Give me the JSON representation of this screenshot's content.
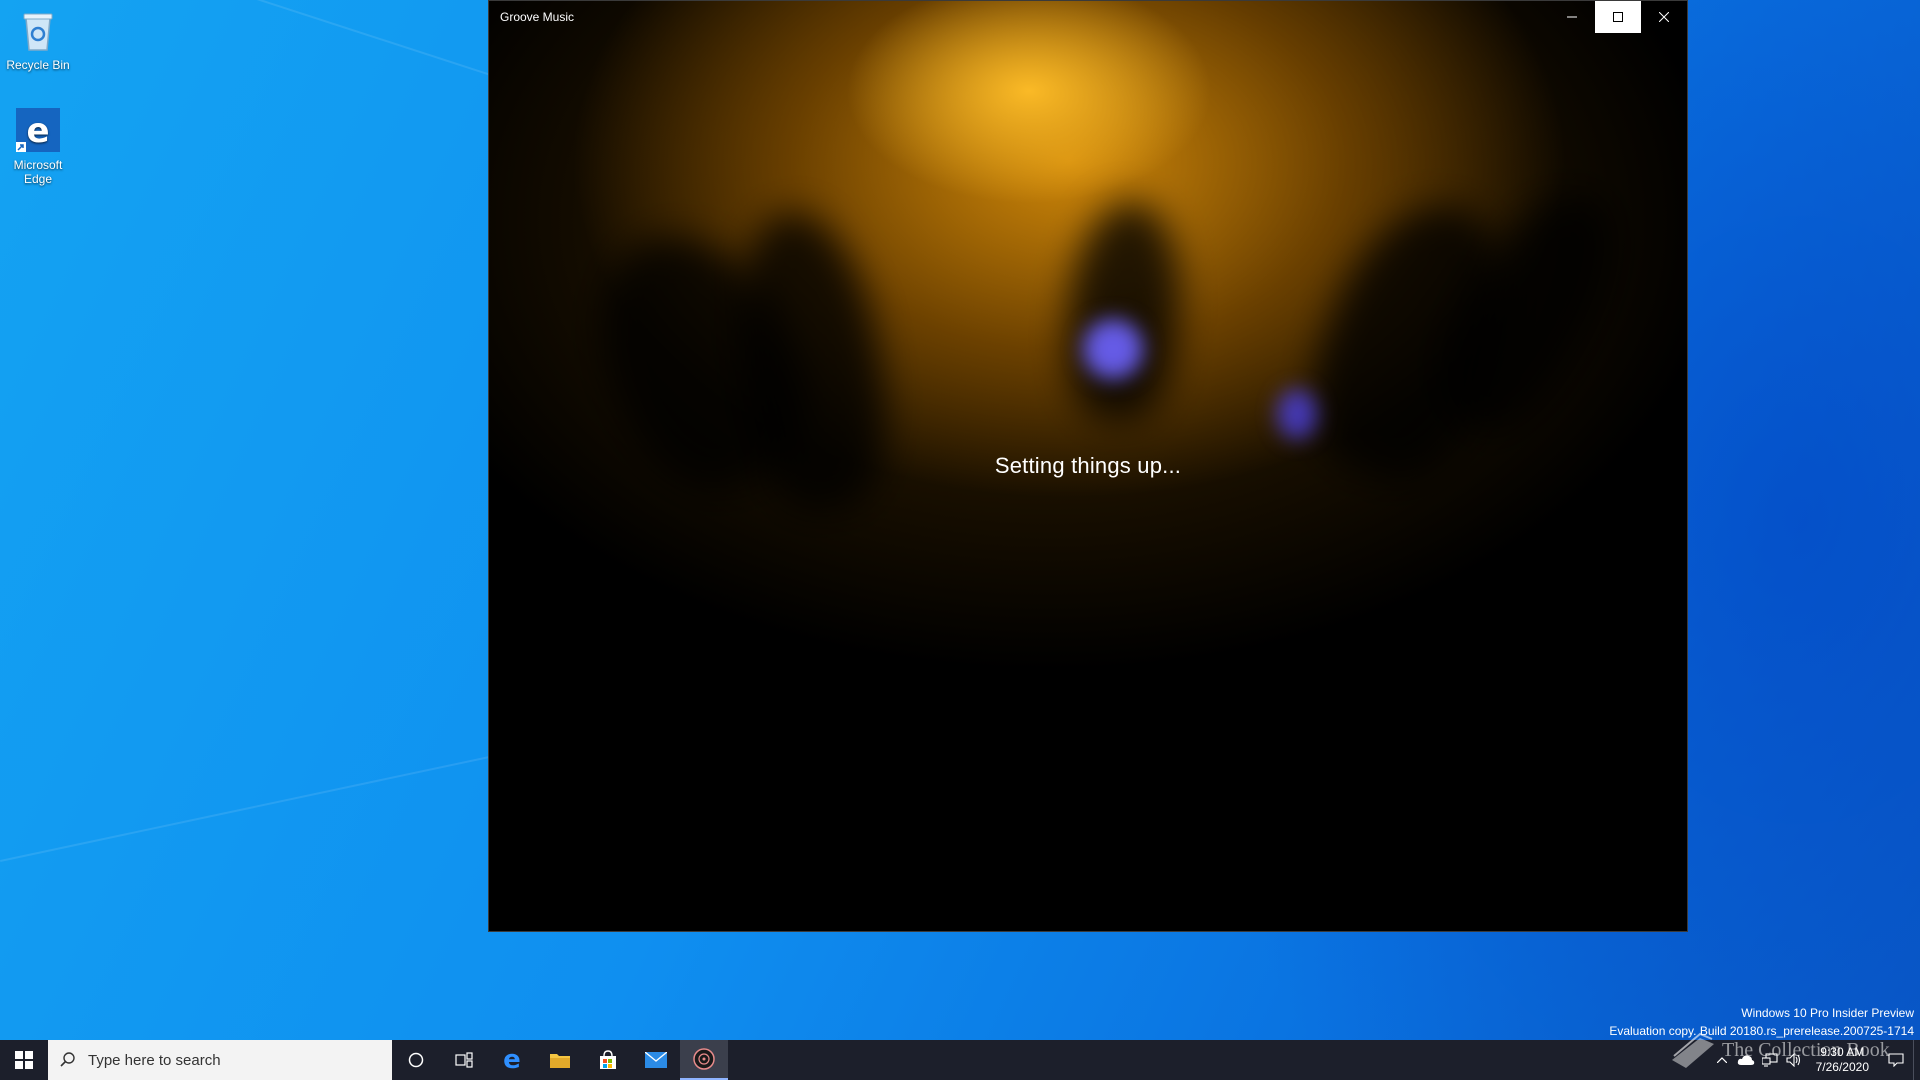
{
  "desktop": {
    "icons": [
      {
        "label": "Recycle Bin",
        "icon": "recycle-bin-icon"
      },
      {
        "label": "Microsoft Edge",
        "icon": "edge-icon"
      }
    ]
  },
  "window": {
    "title": "Groove Music",
    "status": "Setting things up...",
    "buttons": {
      "minimize": "minimize-icon",
      "maximize": "maximize-icon",
      "close": "close-icon"
    }
  },
  "watermark": {
    "line1": "Windows 10 Pro Insider Preview",
    "line2": "Evaluation copy. Build 20180.rs_prerelease.200725-1714"
  },
  "taskbar": {
    "search_placeholder": "Type here to search",
    "apps": [
      "cortana-icon",
      "task-view-icon",
      "edge-icon",
      "file-explorer-icon",
      "store-icon",
      "mail-icon",
      "groove-music-icon"
    ],
    "active_app": "groove-music-icon",
    "clock": {
      "time": "9:30 AM",
      "date": "7/26/2020"
    }
  },
  "overlay": {
    "brand": "The Collection Book"
  },
  "colors": {
    "accent": "#0f8ff0",
    "taskbar": "#1c1f2b",
    "window_bg": "#000000"
  }
}
